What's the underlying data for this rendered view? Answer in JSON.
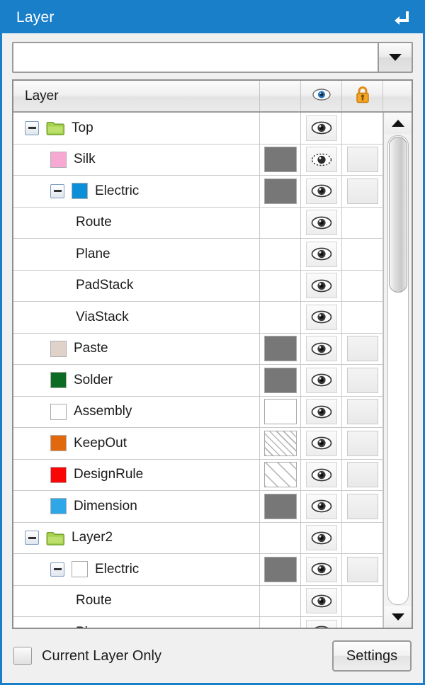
{
  "window": {
    "title": "Layer",
    "pin_icon": "undock-arrow-icon",
    "accent_color": "#1a7fc9"
  },
  "combo": {
    "value": "",
    "placeholder": "",
    "arrow_icon": "chevron-down-icon"
  },
  "table": {
    "columns": [
      {
        "key": "name",
        "label": "Layer",
        "icon": ""
      },
      {
        "key": "color",
        "label": "",
        "icon": ""
      },
      {
        "key": "eye",
        "label": "",
        "icon": "eye-icon"
      },
      {
        "key": "lock",
        "label": "",
        "icon": "lock-icon"
      },
      {
        "key": "extra",
        "label": "",
        "icon": ""
      }
    ],
    "rows": [
      {
        "name": "Top",
        "depth": 0,
        "expander": "collapse",
        "marker": "folder",
        "marker_color": "#a6d24e",
        "pattern": "none",
        "eye": "visible",
        "lock": "none"
      },
      {
        "name": "Silk",
        "depth": 1,
        "expander": "none",
        "marker": "swatch",
        "marker_color": "#f7a9d3",
        "pattern": "gray",
        "eye": "partial",
        "lock": "empty"
      },
      {
        "name": "Electric",
        "depth": 1,
        "expander": "collapse",
        "marker": "swatch",
        "marker_color": "#0a8fd8",
        "pattern": "gray",
        "eye": "visible",
        "lock": "empty"
      },
      {
        "name": "Route",
        "depth": 2,
        "expander": "none",
        "marker": "none",
        "marker_color": "",
        "pattern": "none",
        "eye": "visible",
        "lock": "none"
      },
      {
        "name": "Plane",
        "depth": 2,
        "expander": "none",
        "marker": "none",
        "marker_color": "",
        "pattern": "none",
        "eye": "visible",
        "lock": "none"
      },
      {
        "name": "PadStack",
        "depth": 2,
        "expander": "none",
        "marker": "none",
        "marker_color": "",
        "pattern": "none",
        "eye": "visible",
        "lock": "none"
      },
      {
        "name": "ViaStack",
        "depth": 2,
        "expander": "none",
        "marker": "none",
        "marker_color": "",
        "pattern": "none",
        "eye": "visible",
        "lock": "none"
      },
      {
        "name": "Paste",
        "depth": 1,
        "expander": "none",
        "marker": "swatch",
        "marker_color": "#e0d2c8",
        "pattern": "gray",
        "eye": "visible",
        "lock": "empty"
      },
      {
        "name": "Solder",
        "depth": 1,
        "expander": "none",
        "marker": "swatch",
        "marker_color": "#0b6b22",
        "pattern": "gray",
        "eye": "visible",
        "lock": "empty"
      },
      {
        "name": "Assembly",
        "depth": 1,
        "expander": "none",
        "marker": "swatch",
        "marker_color": "#ffffff",
        "pattern": "white",
        "eye": "visible",
        "lock": "empty"
      },
      {
        "name": "KeepOut",
        "depth": 1,
        "expander": "none",
        "marker": "swatch",
        "marker_color": "#e2680d",
        "pattern": "hatch-dense",
        "eye": "visible",
        "lock": "empty"
      },
      {
        "name": "DesignRule",
        "depth": 1,
        "expander": "none",
        "marker": "swatch",
        "marker_color": "#fb0606",
        "pattern": "hatch-sparse",
        "eye": "visible",
        "lock": "empty"
      },
      {
        "name": "Dimension",
        "depth": 1,
        "expander": "none",
        "marker": "swatch",
        "marker_color": "#2ea7e8",
        "pattern": "gray",
        "eye": "visible",
        "lock": "empty"
      },
      {
        "name": "Layer2",
        "depth": 0,
        "expander": "collapse",
        "marker": "folder",
        "marker_color": "#a6d24e",
        "pattern": "none",
        "eye": "visible",
        "lock": "none"
      },
      {
        "name": "Electric",
        "depth": 1,
        "expander": "collapse",
        "marker": "swatch",
        "marker_color": "#ffffff",
        "pattern": "gray",
        "eye": "visible",
        "lock": "empty"
      },
      {
        "name": "Route",
        "depth": 2,
        "expander": "none",
        "marker": "none",
        "marker_color": "",
        "pattern": "none",
        "eye": "visible",
        "lock": "none"
      },
      {
        "name": "Plane",
        "depth": 2,
        "expander": "none",
        "marker": "none",
        "marker_color": "",
        "pattern": "none",
        "eye": "visible",
        "lock": "none"
      }
    ]
  },
  "scrollbar": {
    "up_icon": "triangle-up-icon",
    "down_icon": "triangle-down-icon",
    "thumb_position_percent": 0,
    "thumb_size_percent": 33
  },
  "footer": {
    "checkbox_label": "Current Layer Only",
    "checkbox_checked": false,
    "settings_label": "Settings"
  }
}
